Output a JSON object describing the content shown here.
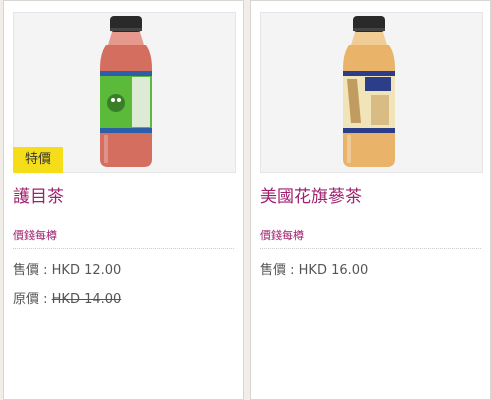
{
  "products": [
    {
      "badge": "特價",
      "name": "護目茶",
      "price_hint": "價錢每樽",
      "sale_label": "售價 : ",
      "sale_price": "HKD 12.00",
      "original_label": "原價 : ",
      "original_price": "HKD 14.00",
      "colors": {
        "liquid": "#d46f60",
        "label": "#5cba3a"
      }
    },
    {
      "name": "美國花旗蔘茶",
      "price_hint": "價錢每樽",
      "sale_label": "售價 : ",
      "sale_price": "HKD 16.00",
      "colors": {
        "liquid": "#e9b36a",
        "label": "#f0e4b8"
      }
    }
  ],
  "theme": {
    "accent": "#a0206e",
    "badge_bg": "#f5dd1a",
    "page_bg": "#f1eee9"
  }
}
